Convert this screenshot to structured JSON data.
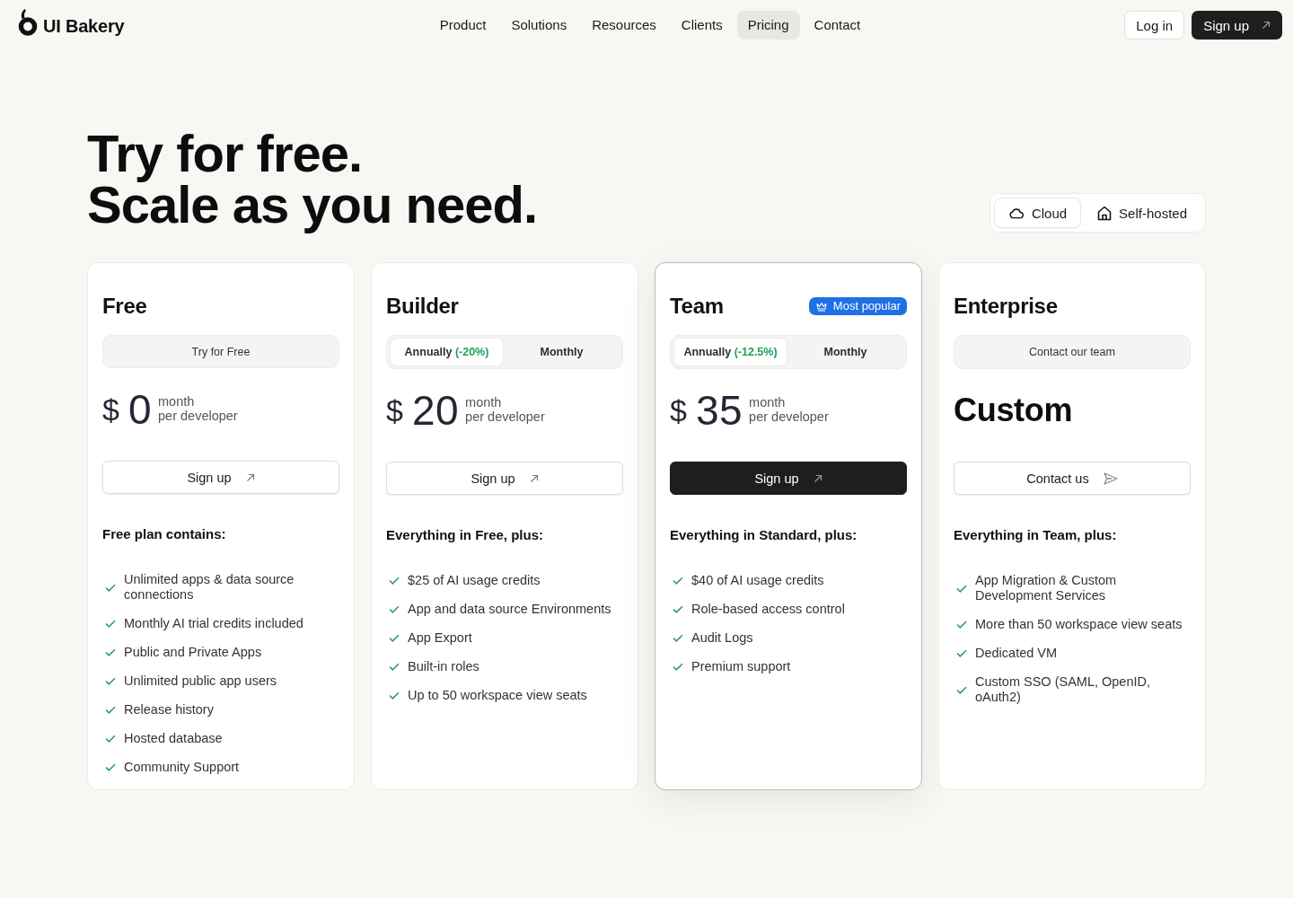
{
  "header": {
    "logo_text": "UI Bakery",
    "nav": [
      {
        "label": "Product",
        "selected": false
      },
      {
        "label": "Solutions",
        "selected": false
      },
      {
        "label": "Resources",
        "selected": false
      },
      {
        "label": "Clients",
        "selected": false
      },
      {
        "label": "Pricing",
        "selected": true
      },
      {
        "label": "Contact",
        "selected": false
      }
    ],
    "login": "Log in",
    "signup": "Sign up"
  },
  "hero": {
    "title_lines": [
      "Try for free.",
      "Scale as you need."
    ]
  },
  "hosting": [
    {
      "label": "Cloud",
      "selected": true
    },
    {
      "label": "Self-hosted",
      "selected": false
    }
  ],
  "plans": [
    {
      "name": "Free",
      "featured": false,
      "billing": {
        "kind": "note",
        "text": "Try for Free"
      },
      "price": {
        "kind": "amount",
        "currency": "$",
        "amount": "0",
        "unit_lines": [
          "month",
          "per developer"
        ]
      },
      "cta": {
        "kind": "signup",
        "label": "Sign up",
        "primary": false
      },
      "features_heading": "Free plan contains:",
      "features": [
        "Unlimited apps & data source connections",
        "Monthly AI trial credits included",
        "Public and Private Apps",
        "Unlimited public app users",
        "Release history",
        "Hosted database",
        "Community Support"
      ]
    },
    {
      "name": "Builder",
      "featured": false,
      "billing": {
        "kind": "toggle",
        "options": [
          {
            "label": "Annually",
            "discount": "(-20%)",
            "selected": true
          },
          {
            "label": "Monthly",
            "selected": false
          }
        ]
      },
      "price": {
        "kind": "amount",
        "currency": "$",
        "amount": "20",
        "unit_lines": [
          "month",
          "per developer"
        ]
      },
      "cta": {
        "kind": "signup",
        "label": "Sign up",
        "primary": false
      },
      "features_heading": "Everything in Free, plus:",
      "features": [
        "$25 of AI usage credits",
        "App and data source Environments",
        "App Export",
        "Built-in roles",
        "Up to 50 workspace view seats"
      ]
    },
    {
      "name": "Team",
      "featured": true,
      "badge": "Most popular",
      "billing": {
        "kind": "toggle",
        "options": [
          {
            "label": "Annually",
            "discount": "(-12.5%)",
            "selected": true
          },
          {
            "label": "Monthly",
            "selected": false
          }
        ]
      },
      "price": {
        "kind": "amount",
        "currency": "$",
        "amount": "35",
        "unit_lines": [
          "month",
          "per developer"
        ]
      },
      "cta": {
        "kind": "signup",
        "label": "Sign up",
        "primary": true
      },
      "features_heading": "Everything in Standard, plus:",
      "features": [
        "$40 of AI usage credits",
        "Role-based access control",
        "Audit Logs",
        "Premium support"
      ]
    },
    {
      "name": "Enterprise",
      "featured": false,
      "billing": {
        "kind": "note",
        "text": "Contact our team"
      },
      "price": {
        "kind": "custom",
        "text": "Custom"
      },
      "cta": {
        "kind": "contact",
        "label": "Contact us",
        "primary": false
      },
      "features_heading": "Everything in Team, plus:",
      "features": [
        "App Migration & Custom Development Services",
        "More than 50 workspace view seats",
        "Dedicated VM",
        "Custom SSO (SAML, OpenID, oAuth2)"
      ]
    }
  ]
}
